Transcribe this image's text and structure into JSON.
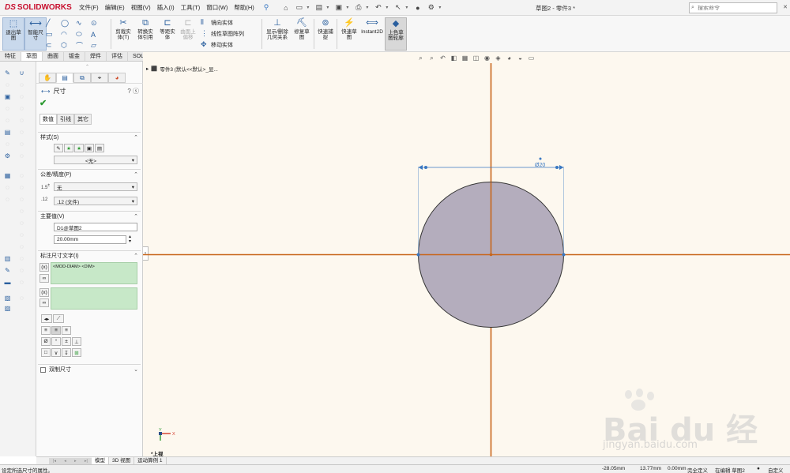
{
  "app": {
    "brand_ds": "DS",
    "brand_name": "SOLIDWORKS"
  },
  "menu": [
    "文件(F)",
    "编辑(E)",
    "视图(V)",
    "插入(I)",
    "工具(T)",
    "窗口(W)",
    "帮助(H)"
  ],
  "window_title": "草图2 - 零件3 *",
  "search": {
    "placeholder": "搜索命令"
  },
  "ribbon": {
    "exit_sketch": "退出草\n图",
    "smart_dim": "智能尺\n寸",
    "trim": "剪裁实\n体(T)",
    "convert": "转换实\n体引用",
    "offset": "等距实\n体",
    "surface_offset": "曲面上\n偏移",
    "mirror": "镜向实体",
    "linear_pattern": "线性草图阵列",
    "move": "移动实体",
    "display_relations": "显示/删除\n几何关系",
    "repair": "修复草\n图",
    "quick_snap": "快速捕\n捉",
    "rapid_sketch": "快速草\n图",
    "instant2d": "Instant2D",
    "shaded_sketch": "上色草\n图轮廓"
  },
  "cm_tabs": [
    "特征",
    "草图",
    "曲面",
    "钣金",
    "焊件",
    "评估",
    "SOLIDWORKS 插件"
  ],
  "pm": {
    "title": "尺寸",
    "help": "?",
    "sub_tabs": [
      "数值",
      "引线",
      "其它"
    ],
    "style_section": "样式(S)",
    "style_value": "<无>",
    "tolerance_section": "公差/精度(P)",
    "tol_type": "无",
    "precision": ".12 (文件)",
    "primary_section": "主要值(V)",
    "primary_name": "D1@草图2",
    "primary_value": "20.00mm",
    "dim_text_section": "标注尺寸文字(I)",
    "dim_text": "<MOD-DIAM> <DIM>",
    "dual_dim": "双制尺寸",
    "symbols": [
      "Ø",
      "°",
      "±",
      "⊥",
      "□",
      "∨",
      "↧",
      "⊞"
    ]
  },
  "tree": {
    "item": "零件3 (默认<<默认>_显..."
  },
  "sketch": {
    "dim_label": "Ø20",
    "view_label": "*上视",
    "axis_x": "X",
    "axis_y": "Y"
  },
  "model_tabs": [
    "模型",
    "3D 视图",
    "运动算例 1"
  ],
  "status": {
    "hint": "设定所选尺寸的属性。",
    "x": "-28.05mm",
    "y": "13.77mm",
    "z": "0.00mm",
    "defined": "完全定义",
    "editing": "在编辑 草图2",
    "custom": "自定义"
  },
  "watermark": {
    "logo": "Bai  du 经验",
    "url": "jingyan.baidu.com"
  },
  "colors": {
    "accent": "#3a78c2",
    "axis": "#c8651a",
    "circle_fill": "#b4adbd",
    "canvas": "#fdf8ef"
  }
}
